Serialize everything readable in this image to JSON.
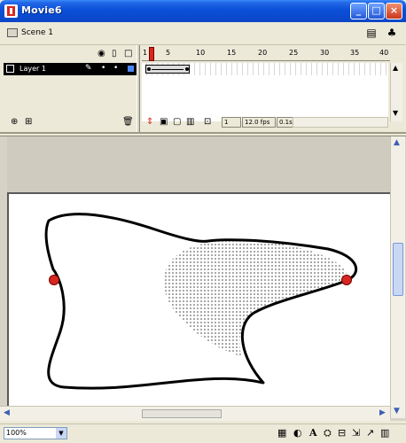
{
  "window": {
    "title": "Movie6",
    "minimize": "_",
    "maximize": "□",
    "close": "×"
  },
  "scene": {
    "label": "Scene 1"
  },
  "timeline": {
    "eye_icon": "eye-icon",
    "lock_icon": "lock-icon",
    "outline_icon": "outline-icon",
    "layer": {
      "name": "Layer 1"
    },
    "ruler_ticks": [
      "1",
      "5",
      "10",
      "15",
      "20",
      "25",
      "30",
      "35",
      "40"
    ],
    "current_frame": "1",
    "frame_rate": "12.0 fps",
    "elapsed": "0.1s"
  },
  "statusbar": {
    "zoom": "100%"
  },
  "colors": {
    "title_blue": "#0a4fd6",
    "stage_white": "#ffffff",
    "control_point": "#d7281f"
  }
}
